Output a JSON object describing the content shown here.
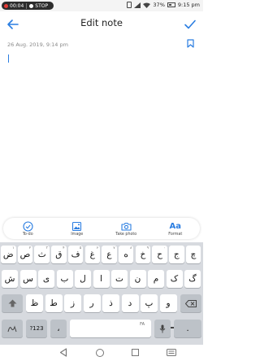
{
  "status": {
    "record_time": "00:04",
    "stop_label": "STOP",
    "battery": "37%",
    "clock": "9:15 pm"
  },
  "app_bar": {
    "title": "Edit note"
  },
  "note": {
    "date": "26 Aug. 2019, 9:14 pm"
  },
  "toolbar": {
    "todo": "To-do",
    "image": "Image",
    "photo": "Take photo",
    "format": "Format",
    "format_glyph": "Aa"
  },
  "keyboard": {
    "row1": [
      {
        "k": "ض",
        "h": "۱"
      },
      {
        "k": "ص",
        "h": "۲"
      },
      {
        "k": "ث",
        "h": "۳"
      },
      {
        "k": "ق",
        "h": "۴"
      },
      {
        "k": "ف",
        "h": "۵"
      },
      {
        "k": "غ",
        "h": "۶"
      },
      {
        "k": "ع",
        "h": "۷"
      },
      {
        "k": "ه",
        "h": "۸"
      },
      {
        "k": "خ",
        "h": "۹"
      },
      {
        "k": "ح",
        "h": "۰"
      },
      {
        "k": "ج",
        "h": ""
      },
      {
        "k": "چ",
        "h": ""
      }
    ],
    "row2": [
      "ش",
      "س",
      "ی",
      "ب",
      "ل",
      "ا",
      "ت",
      "ن",
      "م",
      "ک",
      "گ"
    ],
    "row3": [
      "ظ",
      "ط",
      "ز",
      "ر",
      "ذ",
      "د",
      "پ",
      "و"
    ],
    "row4": {
      "symbols": "?123",
      "comma": "،",
      "space_lang": "FA",
      "period": "."
    }
  },
  "colors": {
    "accent": "#2a7de1",
    "keyboard_bg": "#d7dadf"
  }
}
